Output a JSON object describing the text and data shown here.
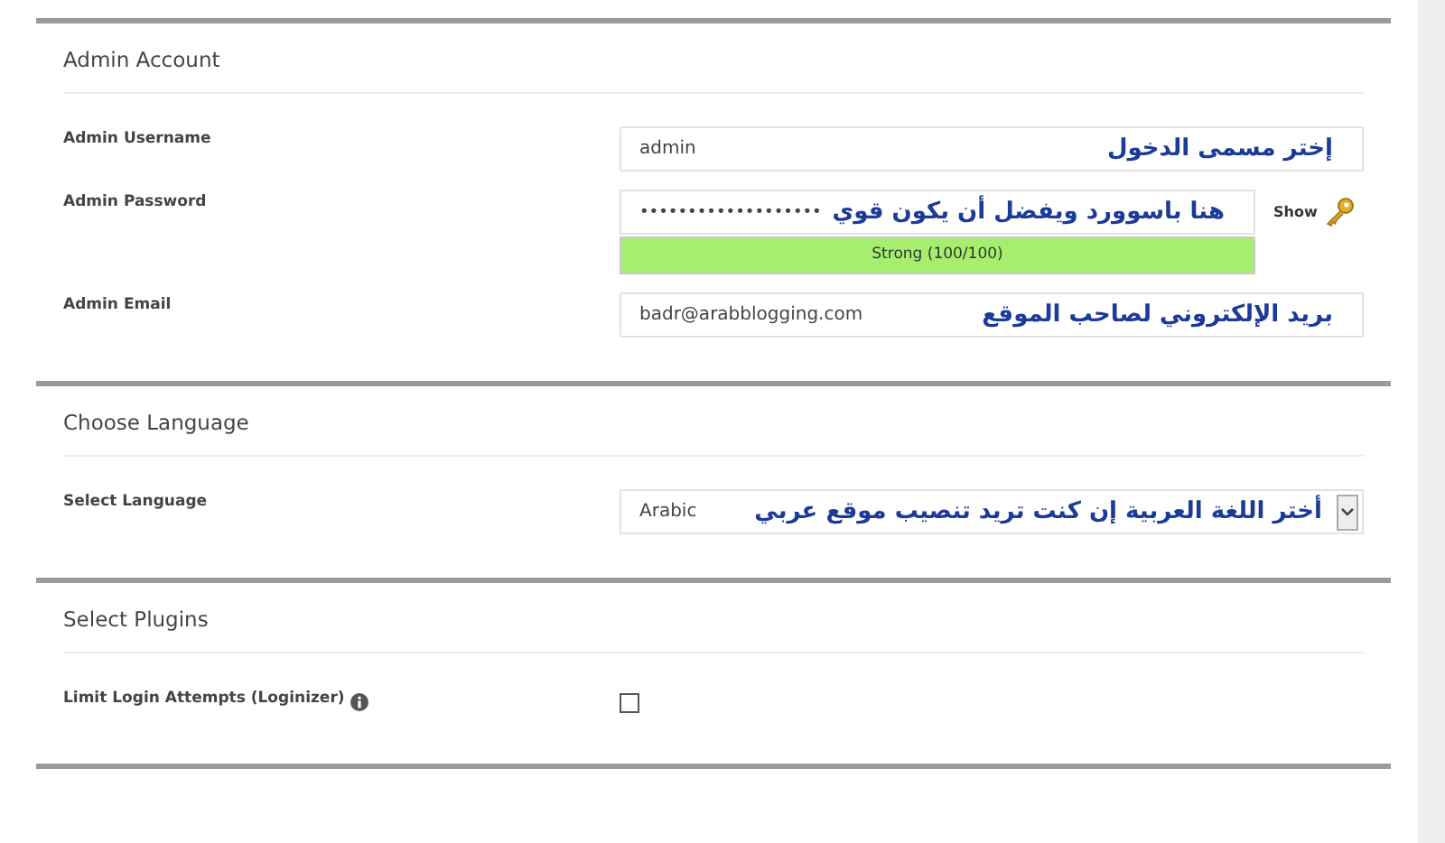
{
  "sections": [
    {
      "title": "Admin Account",
      "rows": [
        {
          "kind": "text",
          "label": "Admin Username",
          "value": "admin",
          "annotation": "إختر مسمى الدخول"
        },
        {
          "kind": "password",
          "label": "Admin Password",
          "value": "•••••••••••••••••••",
          "annotation": "هنا باسوورد ويفضل أن يكون قوي",
          "toggle": "Show",
          "strength": {
            "text": "Strong (100/100)",
            "level": 1
          }
        },
        {
          "kind": "text",
          "label": "Admin Email",
          "value": "badr@arabblogging.com",
          "annotation": "بريد الإلكتروني لصاحب الموقع"
        }
      ]
    },
    {
      "title": "Choose Language",
      "rows": [
        {
          "kind": "select",
          "label": "Select Language",
          "value": "Arabic",
          "annotation": "أختر اللغة العربية إن كنت تريد تنصيب موقع عربي"
        }
      ]
    },
    {
      "title": "Select Plugins",
      "rows": [
        {
          "kind": "checkbox",
          "label": "Limit Login Attempts (Loginizer)",
          "info": true,
          "checked": false
        }
      ]
    }
  ]
}
